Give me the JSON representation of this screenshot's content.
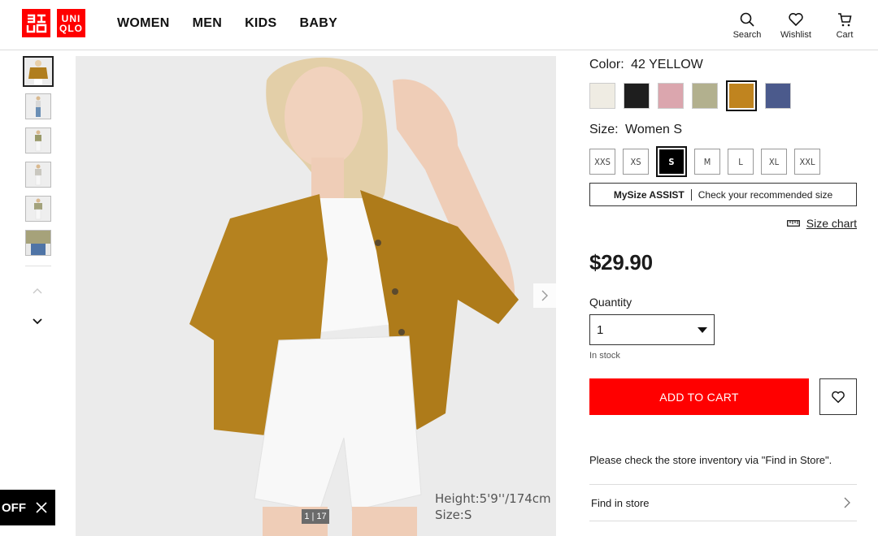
{
  "logo": {
    "top": "UNI",
    "bottom": "QLO",
    "brand_color": "#ff0000"
  },
  "nav": {
    "items": [
      "WOMEN",
      "MEN",
      "KIDS",
      "BABY"
    ]
  },
  "header_icons": {
    "search": "Search",
    "wishlist": "Wishlist",
    "cart": "Cart"
  },
  "gallery": {
    "counter": "1 | 17",
    "model_height": "Height:5'9''/174cm",
    "model_size": "Size:S"
  },
  "promo_tab": {
    "label": "OFF"
  },
  "product": {
    "color_label": "Color:",
    "color_value": "42 YELLOW",
    "colors": [
      "#efece3",
      "#1e1e1e",
      "#dba6ae",
      "#b2b08e",
      "#c0841f",
      "#4b5a8c"
    ],
    "selected_color_index": 4,
    "size_label": "Size:",
    "size_value": "Women S",
    "sizes": [
      "XXS",
      "XS",
      "S",
      "M",
      "L",
      "XL",
      "XXL"
    ],
    "selected_size": "S",
    "mysize_bold": "MySize ASSIST",
    "mysize_text": "Check your recommended size",
    "size_chart": "Size chart",
    "price": "$29.90",
    "quantity_label": "Quantity",
    "quantity_value": "1",
    "stock": "In stock",
    "add_to_cart": "ADD TO CART",
    "store_note": "Please check the store inventory via \"Find in Store\".",
    "find_in_store": "Find in store"
  }
}
